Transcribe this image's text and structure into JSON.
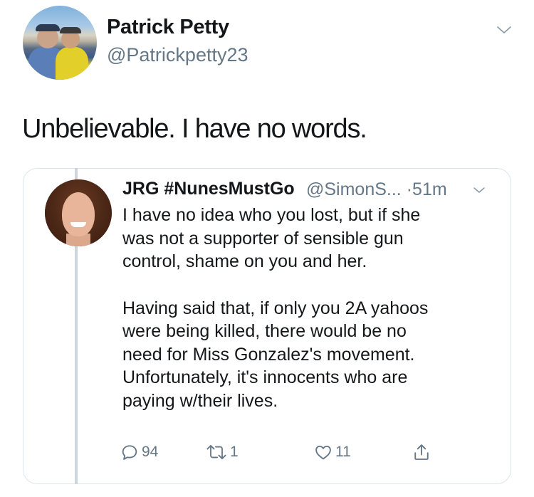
{
  "tweet": {
    "author_name": "Patrick Petty",
    "author_handle": "@Patrickpetty23",
    "text": "Unbelievable. I have no words."
  },
  "quoted": {
    "author_name": "JRG #NunesMustGo",
    "author_handle_truncated": "@SimonS...",
    "separator": "·",
    "time": "51m",
    "paragraph_1": "I have no idea who you lost, but if she\nwas not a supporter of sensible gun\ncontrol, shame on you and her.",
    "paragraph_2": "Having said that, if only you 2A yahoos\nwere being killed, there would be no\nneed for Miss Gonzalez's movement.\nUnfortunately, it's innocents who are\npaying w/their lives.",
    "actions": {
      "reply_icon": "reply-icon",
      "reply_count": "94",
      "retweet_icon": "retweet-icon",
      "retweet_count": "1",
      "like_icon": "like-icon",
      "like_count": "11",
      "share_icon": "share-icon"
    }
  },
  "colors": {
    "text_primary": "#14171a",
    "text_secondary": "#657786",
    "border": "#dfe4e8",
    "thread_line": "#ccd6dd"
  }
}
